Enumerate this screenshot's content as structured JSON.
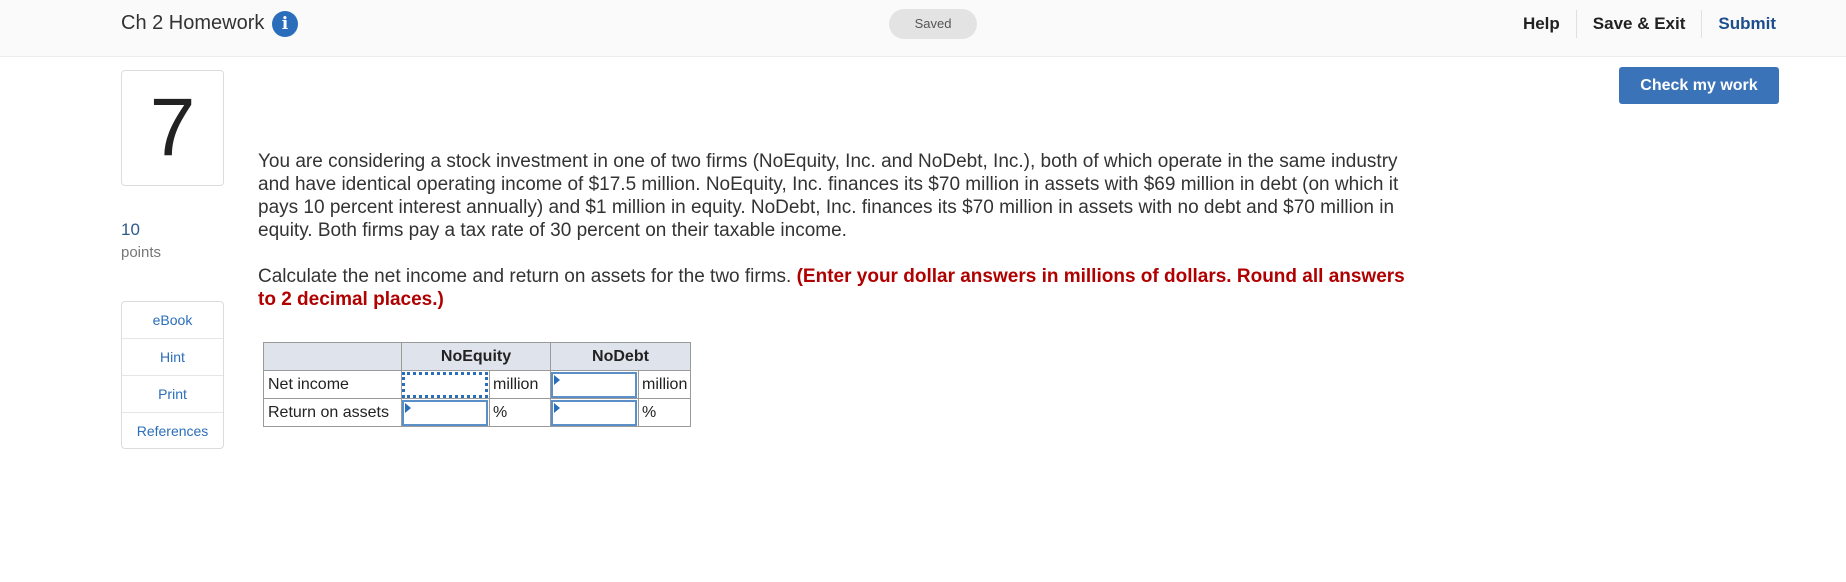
{
  "header": {
    "title": "Ch 2 Homework",
    "saved_status": "Saved",
    "help": "Help",
    "save_exit": "Save & Exit",
    "submit": "Submit"
  },
  "question": {
    "number": "7",
    "points_value": "10",
    "points_label": "points",
    "resources": [
      "eBook",
      "Hint",
      "Print",
      "References"
    ],
    "check_button": "Check my work",
    "paragraph1": "You are considering a stock investment in one of two firms (NoEquity, Inc. and NoDebt, Inc.), both of which operate in the same industry and have identical operating income of $17.5 million. NoEquity, Inc. finances its $70 million in assets with $69 million in debt (on which it pays 10 percent interest annually) and $1 million in equity. NoDebt, Inc. finances its $70 million in assets with no debt and $70 million in equity. Both firms pay a tax rate of 30 percent on their taxable income.",
    "paragraph2_text": "Calculate the net income and return on assets for the two firms. ",
    "paragraph2_instruction": "(Enter your dollar answers in millions of dollars. Round all answers to 2 decimal places.)"
  },
  "answer_table": {
    "columns": [
      "",
      "NoEquity",
      "NoDebt"
    ],
    "rows": [
      {
        "label": "Net income",
        "noequity_value": "",
        "noequity_unit": "million",
        "nodebt_value": "",
        "nodebt_unit": "million"
      },
      {
        "label": "Return on assets",
        "noequity_value": "",
        "noequity_unit": "%",
        "nodebt_value": "",
        "nodebt_unit": "%"
      }
    ]
  },
  "colors": {
    "accent": "#2a6ebb",
    "check_button": "#3a73b8",
    "instruction_red": "#b00000"
  }
}
